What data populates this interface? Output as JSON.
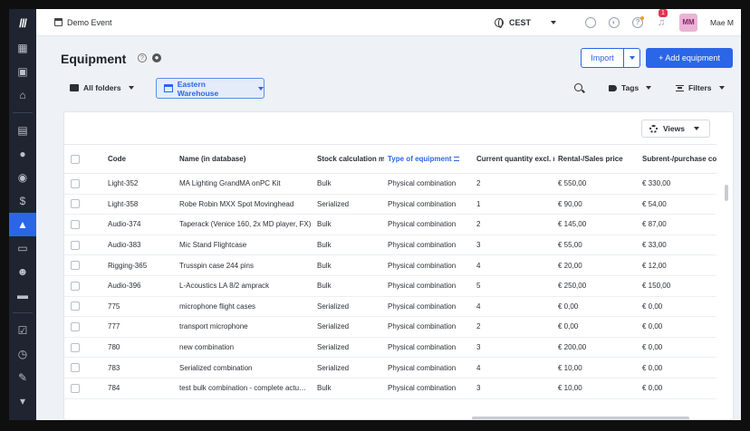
{
  "topbar": {
    "event": "Demo Event",
    "timezone": "CEST",
    "notifications_count": "1",
    "avatar_initials": "MM",
    "username": "Mae M"
  },
  "header": {
    "title": "Equipment",
    "import_label": "Import",
    "add_label": "+ Add equipment"
  },
  "filters": {
    "folders": "All folders",
    "warehouse": "Eastern Warehouse",
    "tags": "Tags",
    "filters": "Filters"
  },
  "views_label": "Views",
  "columns": [
    "Code",
    "Name (in database)",
    "Stock calculation met",
    "Type of equipment",
    "Current quantity excl. res",
    "Rental-/Sales price",
    "Subrent-/purchase cost"
  ],
  "rows": [
    [
      "Light-352",
      "MA Lighting GrandMA onPC Kit",
      "Bulk",
      "Physical combination",
      "2",
      "€ 550,00",
      "€ 330,00"
    ],
    [
      "Light-358",
      "Robe Robin MXX Spot Movinghead",
      "Serialized",
      "Physical combination",
      "1",
      "€ 90,00",
      "€ 54,00"
    ],
    [
      "Audio-374",
      "Taperack (Venice 160, 2x MD player, FX)",
      "Bulk",
      "Physical combination",
      "2",
      "€ 145,00",
      "€ 87,00"
    ],
    [
      "Audio-383",
      "Mic Stand Flightcase",
      "Bulk",
      "Physical combination",
      "3",
      "€ 55,00",
      "€ 33,00"
    ],
    [
      "Rigging-365",
      "Trusspin case 244 pins",
      "Bulk",
      "Physical combination",
      "4",
      "€ 20,00",
      "€ 12,00"
    ],
    [
      "Audio-396",
      "L-Acoustics LA 8/2 amprack",
      "Bulk",
      "Physical combination",
      "5",
      "€ 250,00",
      "€ 150,00"
    ],
    [
      "775",
      "microphone flight cases",
      "Serialized",
      "Physical combination",
      "4",
      "€ 0,00",
      "€ 0,00"
    ],
    [
      "777",
      "transport microphone",
      "Serialized",
      "Physical combination",
      "2",
      "€ 0,00",
      "€ 0,00"
    ],
    [
      "780",
      "new combination",
      "Serialized",
      "Physical combination",
      "3",
      "€ 200,00",
      "€ 0,00"
    ],
    [
      "783",
      "Serialized combination",
      "Serialized",
      "Physical combination",
      "4",
      "€ 10,00",
      "€ 0,00"
    ],
    [
      "784",
      "test bulk combination - complete actu…",
      "Bulk",
      "Physical combination",
      "3",
      "€ 10,00",
      "€ 0,00"
    ]
  ],
  "colors": {
    "accent": "#2a66e6",
    "sidebar": "#1f2430"
  }
}
